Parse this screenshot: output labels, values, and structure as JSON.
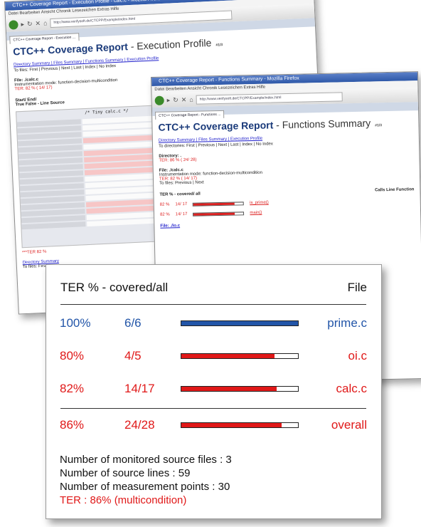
{
  "colors": {
    "blue": "#2255a8",
    "red": "#e01818",
    "ink": "#111111"
  },
  "window_back": {
    "titlebar": "CTC++ Coverage Report - Execution Profile - calc.c - Mozilla Firefox",
    "menu": "Datei  Bearbeiten  Ansicht  Chronik  Lesezeichen  Extras  Hilfe",
    "url": "http://www.verifysoft.de/CTCPP/Example/index.html",
    "tab": "CTC++ Coverage Report - Execution ...",
    "title_main": "CTC++ Coverage Report",
    "title_sub": " - Execution Profile",
    "title_hint": "#1/3",
    "nav_links": "Directory Summary | Files Summary | Functions Summary | Execution Profile",
    "nav_line2": "To files: First | Previous | Next | Last | Index | No Index",
    "file_label": "File: ./calc.c",
    "instr_label": "Instrumentation mode: function-decision-multicondition",
    "ter_label": "TER: 82 % ( 14/ 17)",
    "start_end": "Start/  End/",
    "true_false": "True False - Line Source",
    "code_text": "/* Tiny calc.c */",
    "footer_red": "***TER 82 %",
    "footer_links": "Directory Summary",
    "footer_nav": "To files: First"
  },
  "window_front": {
    "titlebar": "CTC++ Coverage Report - Functions Summary - Mozilla Firefox",
    "menu": "Datei  Bearbeiten  Ansicht  Chronik  Lesezeichen  Extras  Hilfe",
    "url": "http://www.verifysoft.de/CTCPP/Example/index.html",
    "tab": "CTC++ Coverage Report - Functions ...",
    "title_main": "CTC++ Coverage Report",
    "title_sub": " - Functions Summary",
    "title_hint": "#1/3",
    "nav_links": "Directory Summary | Files Summary | Execution Profile",
    "nav_line2": "To directories: First | Previous | Next | Last | Index | No Index",
    "directory_label": "Directory: .",
    "dir_ter": "TER: 86 % ( 24/ 28)",
    "file_label": "File: ./calc.c",
    "instr_label": "Instrumentation mode: function-decision-multicondition",
    "ter_label": "TER: 82 % ( 14/ 17)",
    "to_files": "To files: Previous | Next",
    "table_header": "TER % -  covered/ all",
    "table_header_right": "Calls  Line  Function",
    "row1_pct": "82 %",
    "row1_frac": "14/ 17",
    "row1_func": "is_prime()",
    "row2_pct": "82 %",
    "row2_frac": "14/ 17",
    "row2_func": "main()",
    "file_next": "File: ./io.c"
  },
  "summary": {
    "header_left": "TER % - covered/all",
    "header_right": "File",
    "rows": [
      {
        "pct": "100%",
        "count": "6/6",
        "file": "prime.c",
        "fraction": 1.0,
        "color": "#2255a8"
      },
      {
        "pct": "80%",
        "count": "4/5",
        "file": "oi.c",
        "fraction": 0.8,
        "color": "#e01818"
      },
      {
        "pct": "82%",
        "count": "14/17",
        "file": "calc.c",
        "fraction": 0.82,
        "color": "#e01818"
      }
    ],
    "overall": {
      "pct": "86%",
      "count": "24/28",
      "file": "overall",
      "fraction": 0.86,
      "color": "#e01818"
    },
    "stats": [
      "Number of monitored source files : 3",
      "Number of source lines : 59",
      "Number of measurement points : 30"
    ],
    "ter_line": "TER : 86% (multicondition)"
  }
}
